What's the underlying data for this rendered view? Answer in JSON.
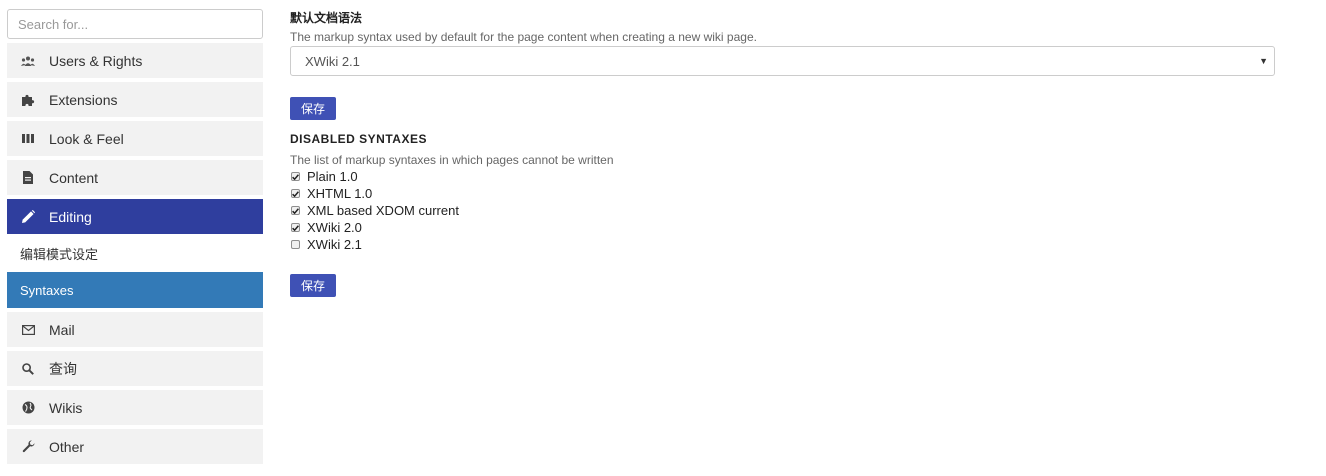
{
  "sidebar": {
    "search_placeholder": "Search for...",
    "items": [
      {
        "label": "Users & Rights",
        "icon": "users-icon"
      },
      {
        "label": "Extensions",
        "icon": "puzzle-icon"
      },
      {
        "label": "Look & Feel",
        "icon": "columns-icon"
      },
      {
        "label": "Content",
        "icon": "document-icon"
      },
      {
        "label": "Editing",
        "icon": "pencil-icon"
      },
      {
        "label": "Mail",
        "icon": "envelope-icon"
      },
      {
        "label": "查询",
        "icon": "search-icon"
      },
      {
        "label": "Wikis",
        "icon": "globe-icon"
      },
      {
        "label": "Other",
        "icon": "wrench-icon"
      }
    ],
    "active_item": "Editing",
    "editing_sub": {
      "label": "编辑模式设定",
      "selected_item": "Syntaxes"
    }
  },
  "main": {
    "default_syntax": {
      "title": "默认文档语法",
      "description": "The markup syntax used by default for the page content when creating a new wiki page.",
      "selected": "XWiki 2.1"
    },
    "save_label": "保存",
    "disabled_syntaxes": {
      "title": "DISABLED SYNTAXES",
      "description": "The list of markup syntaxes in which pages cannot be written",
      "options": [
        {
          "label": "Plain 1.0",
          "checked": true
        },
        {
          "label": "XHTML 1.0",
          "checked": true
        },
        {
          "label": "XML based XDOM current",
          "checked": true
        },
        {
          "label": "XWiki 2.0",
          "checked": true
        },
        {
          "label": "XWiki 2.1",
          "checked": false
        }
      ]
    },
    "save_label_2": "保存"
  },
  "colors": {
    "active_nav": "#2f3e9e",
    "selected_sub": "#337ab7",
    "button": "#3f51b5",
    "nav_bg": "#f2f2f2"
  }
}
